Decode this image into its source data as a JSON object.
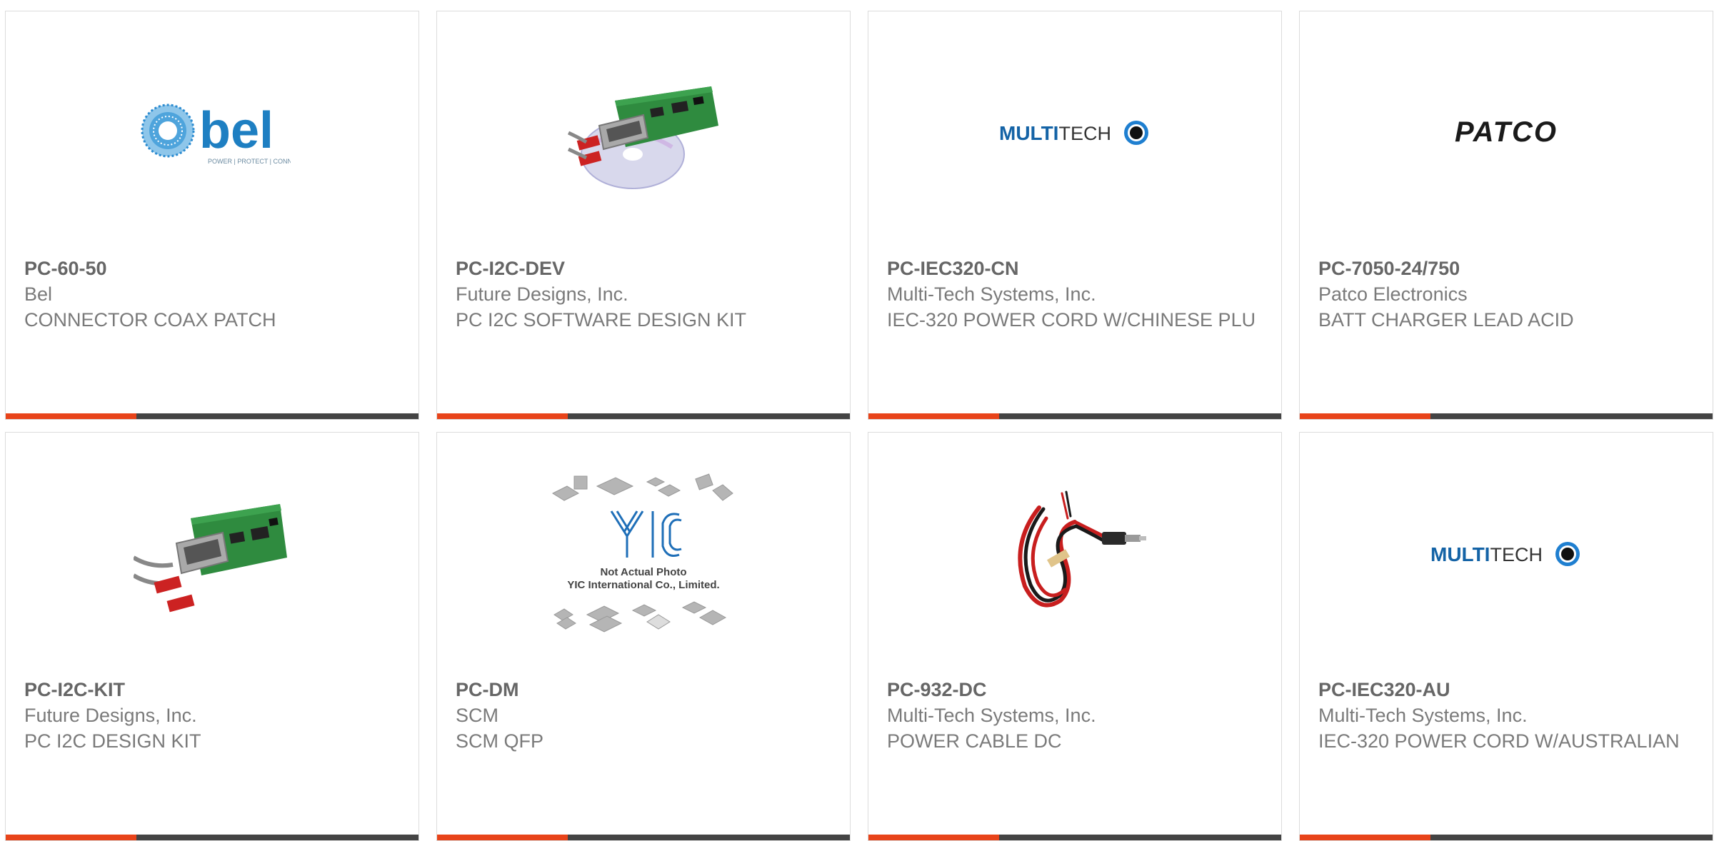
{
  "products": [
    {
      "part": "PC-60-50",
      "manufacturer": "Bel",
      "description": "CONNECTOR COAX PATCH",
      "image": {
        "kind": "bel-logo",
        "wordmark": "bel",
        "tagline": "POWER | PROTECT | CONNECT"
      }
    },
    {
      "part": "PC-I2C-DEV",
      "manufacturer": "Future Designs, Inc.",
      "description": "PC I2C SOFTWARE DESIGN KIT",
      "image": {
        "kind": "board-with-cd"
      }
    },
    {
      "part": "PC-IEC320-CN",
      "manufacturer": "Multi-Tech Systems, Inc.",
      "description": "IEC-320 POWER CORD W/CHINESE PLU",
      "image": {
        "kind": "multitech-logo",
        "bold": "MULTI",
        "light": "TECH"
      }
    },
    {
      "part": "PC-7050-24/750",
      "manufacturer": "Patco Electronics",
      "description": "BATT CHARGER LEAD ACID",
      "image": {
        "kind": "patco-logo",
        "wordmark": "PATCO"
      }
    },
    {
      "part": "PC-I2C-KIT",
      "manufacturer": "Future Designs, Inc.",
      "description": "PC I2C DESIGN KIT",
      "image": {
        "kind": "board"
      }
    },
    {
      "part": "PC-DM",
      "manufacturer": "SCM",
      "description": "SCM QFP",
      "image": {
        "kind": "yic-placeholder",
        "line1": "Not Actual Photo",
        "line2": "YIC International Co., Limited."
      }
    },
    {
      "part": "PC-932-DC",
      "manufacturer": "Multi-Tech Systems, Inc.",
      "description": "POWER CABLE DC",
      "image": {
        "kind": "cable"
      }
    },
    {
      "part": "PC-IEC320-AU",
      "manufacturer": "Multi-Tech Systems, Inc.",
      "description": "IEC-320 POWER CORD W/AUSTRALIAN",
      "image": {
        "kind": "multitech-logo",
        "bold": "MULTI",
        "light": "TECH"
      }
    }
  ],
  "colors": {
    "accent": "#e8441a",
    "bar": "#444444",
    "border": "#dcdcdc",
    "bel_blue": "#1e7fc2",
    "multitech_blue": "#1463a6"
  }
}
